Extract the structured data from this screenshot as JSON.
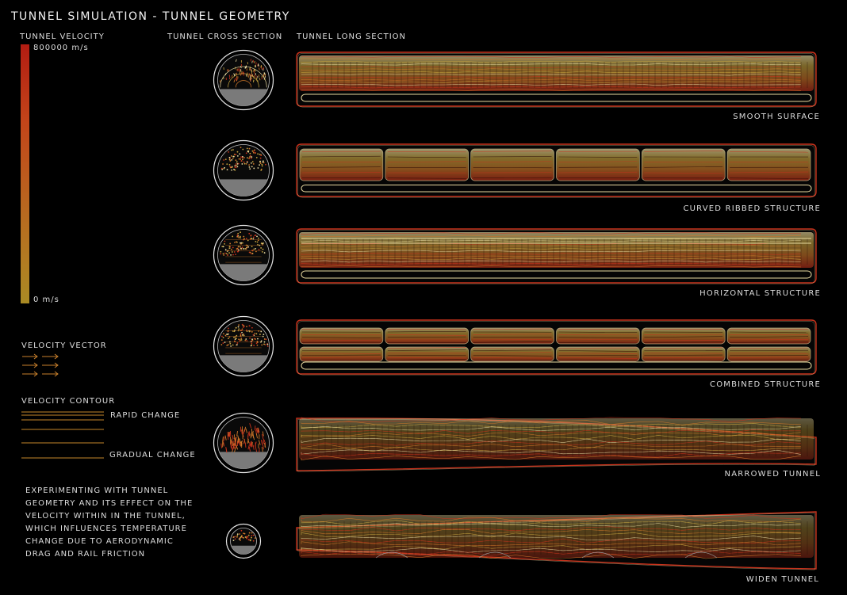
{
  "title": "TUNNEL SIMULATION - TUNNEL GEOMETRY",
  "headers": {
    "velocity": "TUNNEL VELOCITY",
    "cross_section": "TUNNEL CROSS SECTION",
    "long_section": "TUNNEL LONG SECTION"
  },
  "legend": {
    "max_label": "800000 m/s",
    "min_label": "0 m/s",
    "gradient_top": "#b21c12",
    "gradient_bottom": "#a98a24",
    "vector_label": "VELOCITY VECTOR",
    "contour_label": "VELOCITY CONTOUR",
    "rapid_change": "RAPID CHANGE",
    "gradual_change": "GRADUAL CHANGE"
  },
  "description": [
    "EXPERIMENTING WITH TUNNEL",
    "GEOMETRY AND ITS EFFECT ON THE",
    "VELOCITY WITHIN IN THE TUNNEL,",
    "WHICH INFLUENCES TEMPERATURE",
    "CHANGE DUE TO AERODYNAMIC",
    "DRAG AND RAIL FRICTION"
  ],
  "tunnels": [
    {
      "caption": "SMOOTH SURFACE"
    },
    {
      "caption": "CURVED RIBBED STRUCTURE"
    },
    {
      "caption": "HORIZONTAL STRUCTURE"
    },
    {
      "caption": "COMBINED STRUCTURE"
    },
    {
      "caption": "NARROWED TUNNEL"
    },
    {
      "caption": "WIDEN TUNNEL"
    }
  ],
  "colors": {
    "background": "#000000",
    "high": "#c8321c",
    "mid": "#d0782a",
    "low": "#c9a640",
    "pale": "#e8d9a0"
  }
}
